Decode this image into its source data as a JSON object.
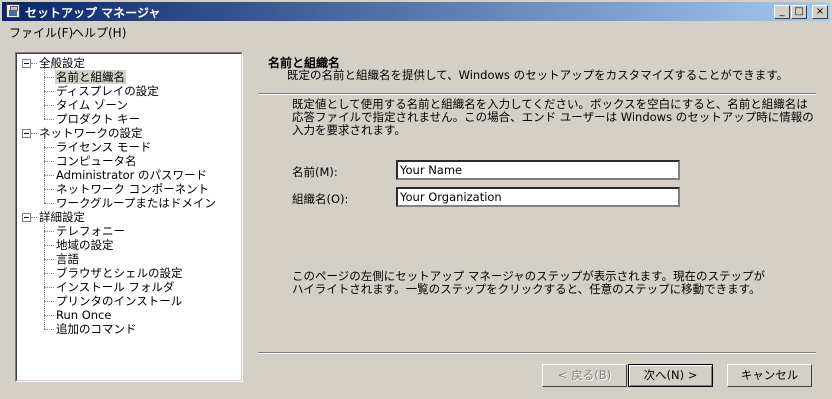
{
  "window": {
    "title": "セットアップ マネージャ"
  },
  "menu": [
    {
      "label": "ファイル(F)"
    },
    {
      "label": "ヘルプ(H)"
    }
  ],
  "tree": {
    "groups": [
      {
        "label": "全般設定",
        "items": [
          "名前と組織名",
          "ディスプレイの設定",
          "タイム ゾーン",
          "プロダクト キー"
        ]
      },
      {
        "label": "ネットワークの設定",
        "items": [
          "ライセンス モード",
          "コンピュータ名",
          "Administrator のパスワード",
          "ネットワーク コンポーネント",
          "ワークグループまたはドメイン"
        ]
      },
      {
        "label": "詳細設定",
        "items": [
          "テレフォニー",
          "地域の設定",
          "言語",
          "ブラウザとシェルの設定",
          "インストール フォルダ",
          "プリンタのインストール",
          "Run Once",
          "追加のコマンド"
        ]
      }
    ],
    "selected": "名前と組織名"
  },
  "header": {
    "title": "名前と組織名",
    "description": "既定の名前と組織名を提供して、Windows のセットアップをカスタマイズすることができます。"
  },
  "body": {
    "instructions": "既定値として使用する名前と組織名を入力してください。ボックスを空白にすると、名前と組織名は応答ファイルで指定されません。この場合、エンド ユーザーは Windows のセットアップ時に情報の入力を要求されます。",
    "hint": "このページの左側にセットアップ マネージャのステップが表示されます。現在のステップがハイライトされます。一覧のステップをクリックすると、任意のステップに移動できます。"
  },
  "form": {
    "name_label": "名前(M):",
    "name_value": "Your Name",
    "org_label": "組織名(O):",
    "org_value": "Your Organization"
  },
  "buttons": {
    "back": "< 戻る(B)",
    "next": "次へ(N) >",
    "cancel": "キャンセル"
  }
}
